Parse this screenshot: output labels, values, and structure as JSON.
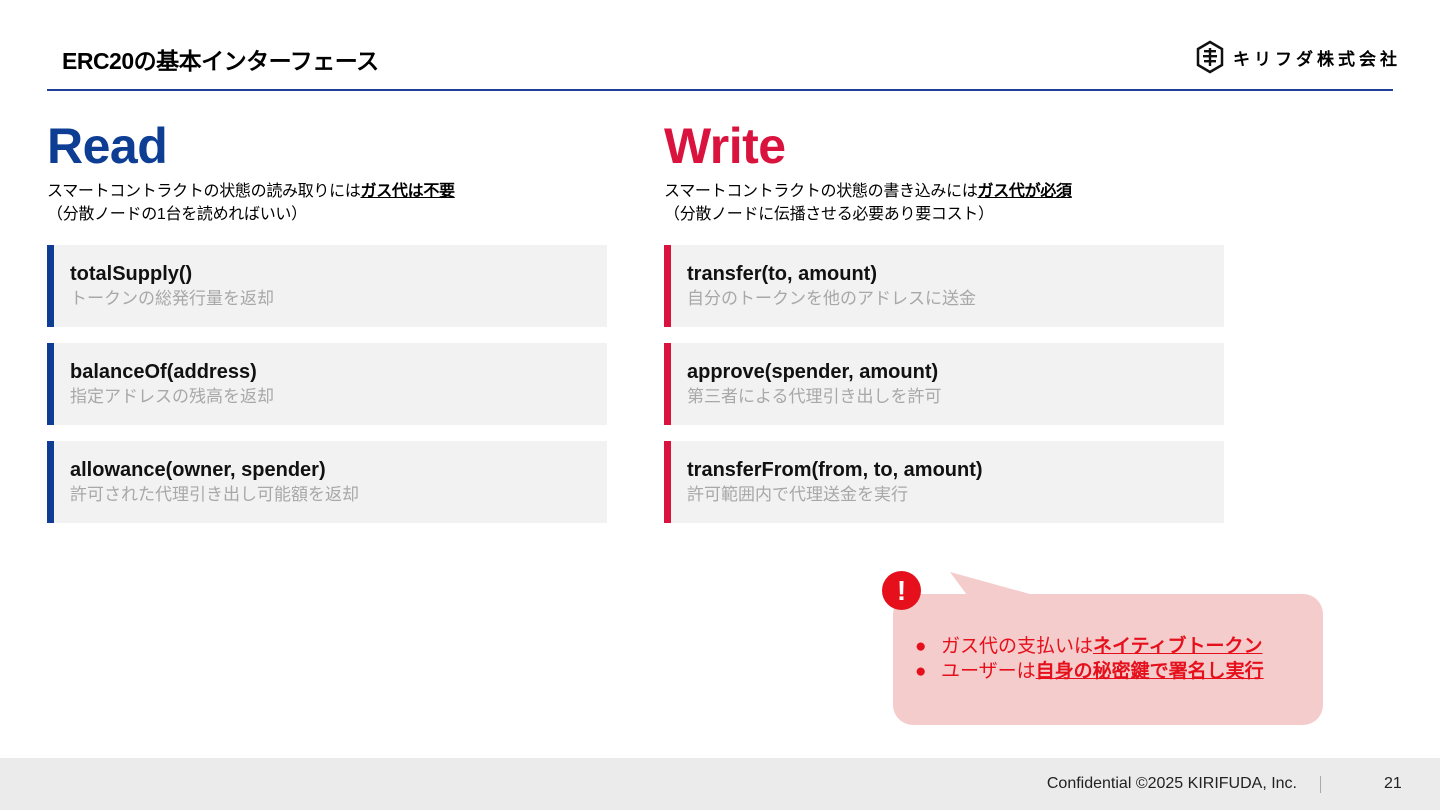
{
  "slide": {
    "title": "ERC20の基本インターフェース",
    "logo_text": "キリフダ株式会社"
  },
  "read": {
    "heading": "Read",
    "desc_prefix": "スマートコントラクトの状態の読み取りには",
    "desc_strong": "ガス代は不要",
    "desc_line2": "（分散ノードの1台を読めればいい）",
    "cards": [
      {
        "title": "totalSupply()",
        "sub": "トークンの総発行量を返却"
      },
      {
        "title": "balanceOf(address)",
        "sub": "指定アドレスの残高を返却"
      },
      {
        "title": "allowance(owner, spender)",
        "sub": "許可された代理引き出し可能額を返却"
      }
    ]
  },
  "write": {
    "heading": "Write",
    "desc_prefix": "スマートコントラクトの状態の書き込みには",
    "desc_strong": "ガス代が必須",
    "desc_line2": "（分散ノードに伝播させる必要あり要コスト）",
    "cards": [
      {
        "title": "transfer(to, amount)",
        "sub": "自分のトークンを他のアドレスに送金"
      },
      {
        "title": "approve(spender, amount)",
        "sub": "第三者による代理引き出しを許可"
      },
      {
        "title": "transferFrom(from, to, amount)",
        "sub": "許可範囲内で代理送金を実行"
      }
    ]
  },
  "callout": {
    "badge": "!",
    "bullet": "●",
    "items": [
      {
        "prefix": "ガス代の支払いは",
        "emphasis": "ネイティブトークン"
      },
      {
        "prefix": "ユーザーは",
        "emphasis": "自身の秘密鍵で署名し実行"
      }
    ]
  },
  "footer": {
    "confidential": "Confidential ©2025 KIRIFUDA, Inc.",
    "page_number": "21"
  },
  "colors": {
    "read_accent": "#0d3e94",
    "write_accent": "#d9133e",
    "callout_bg": "#f5cccc",
    "callout_text": "#e5101c"
  }
}
